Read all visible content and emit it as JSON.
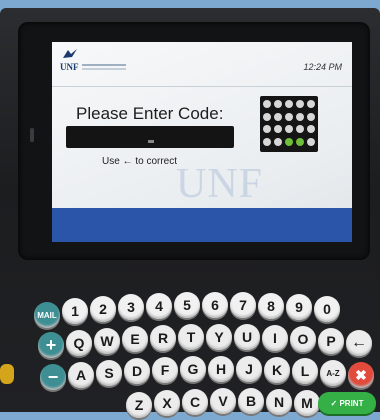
{
  "screen": {
    "logo_text": "UNF",
    "clock": "12:24 PM",
    "prompt": "Please Enter Code:",
    "hint": "Use ← to correct",
    "watermark": "UNF"
  },
  "keyboard": {
    "number_row": [
      "1",
      "2",
      "3",
      "4",
      "5",
      "6",
      "7",
      "8",
      "9",
      "0"
    ],
    "row_q": [
      "Q",
      "W",
      "E",
      "R",
      "T",
      "Y",
      "U",
      "I",
      "O",
      "P"
    ],
    "row_a": [
      "A",
      "S",
      "D",
      "F",
      "G",
      "H",
      "J",
      "K",
      "L",
      "A-Z"
    ],
    "row_z": [
      "Z",
      "X",
      "C",
      "V",
      "B",
      "N",
      "M"
    ],
    "mail_label": "MAIL",
    "backspace_glyph": "←",
    "clear_glyph": "✖",
    "plus_glyph": "+",
    "minus_glyph": "−",
    "print_label": "✓ PRINT"
  },
  "colors": {
    "background": "#7da8cf",
    "screen_footer": "#2a55a8",
    "accent_teal": "#3e8f94",
    "print_green": "#35b046",
    "clear_red": "#e14a3c"
  }
}
